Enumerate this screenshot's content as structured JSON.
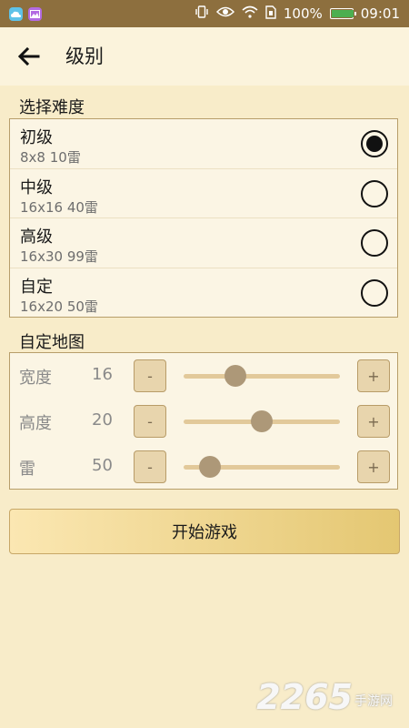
{
  "status": {
    "battery_text": "100%",
    "battery_level": 1.0,
    "time": "09:01"
  },
  "appbar": {
    "title": "级别"
  },
  "difficulty": {
    "title": "选择难度",
    "levels": [
      {
        "name": "初级",
        "desc": "8x8  10雷",
        "selected": true
      },
      {
        "name": "中级",
        "desc": "16x16  40雷",
        "selected": false
      },
      {
        "name": "高级",
        "desc": "16x30  99雷",
        "selected": false
      },
      {
        "name": "自定",
        "desc": "16x20  50雷",
        "selected": false
      }
    ]
  },
  "custom_map": {
    "title": "自定地图",
    "minus_label": "-",
    "plus_label": "+",
    "rows": [
      {
        "label": "宽度",
        "value": "16",
        "slider": 0.33
      },
      {
        "label": "高度",
        "value": "20",
        "slider": 0.5
      },
      {
        "label": "雷",
        "value": "50",
        "slider": 0.17
      }
    ]
  },
  "start_button": {
    "label": "开始游戏"
  },
  "watermark": {
    "number": "2265",
    "suffix": "手游网"
  },
  "colors": {
    "status_bar": "#8d6f3e",
    "background": "#f8ecc9",
    "accent": "#e4c772"
  }
}
